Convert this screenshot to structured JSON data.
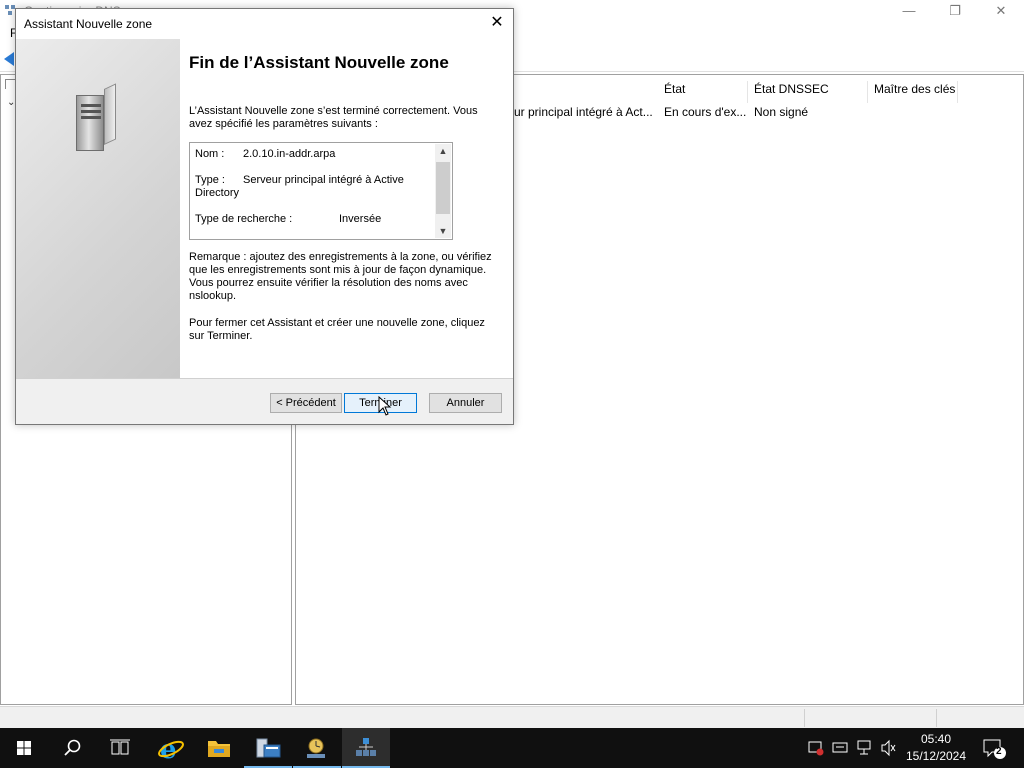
{
  "background_window": {
    "title": "Gestionnaire DNS",
    "menu_first": "F",
    "controls": {
      "minimize": "—",
      "restore": "❐",
      "close": "✕"
    },
    "columns": [
      "État",
      "État DNSSEC",
      "Maître des clés"
    ],
    "row": {
      "type": "ur principal intégré à Act...",
      "state": "En cours d'ex...",
      "dnssec": "Non signé",
      "key_master": ""
    }
  },
  "dialog": {
    "title": "Assistant Nouvelle zone",
    "close_symbol": "✕",
    "heading": "Fin de l’Assistant Nouvelle zone",
    "intro": "L’Assistant Nouvelle zone s’est terminé correctement. Vous avez spécifié les paramètres suivants :",
    "summary": {
      "name_label": "Nom :",
      "name_value": "2.0.10.in-addr.arpa",
      "type_label": "Type :",
      "type_value_1": "Serveur principal intégré à Active",
      "type_value_2": "Directory",
      "lookup_label": "Type de recherche :",
      "lookup_value": "Inversée"
    },
    "note": "Remarque : ajoutez des enregistrements à la zone, ou vérifiez que les enregistrements sont mis à jour de façon dynamique. Vous pourrez ensuite vérifier la résolution des noms avec nslookup.",
    "finish_text": "Pour fermer cet Assistant et créer une nouvelle zone, cliquez sur Terminer.",
    "buttons": {
      "back": "< Précédent",
      "finish": "Terminer",
      "cancel": "Annuler"
    }
  },
  "taskbar": {
    "time": "05:40",
    "date": "15/12/2024",
    "notification_count": "2",
    "items": [
      "start-icon",
      "search-icon",
      "task-view-icon",
      "internet-explorer-icon",
      "file-explorer-icon",
      "server-manager-icon",
      "dns-manager-icon",
      "dns-zone-app-icon"
    ]
  },
  "colors": {
    "accent": "#0078d7",
    "taskbar": "#101010",
    "dialog_bg": "#f0f0f0"
  }
}
